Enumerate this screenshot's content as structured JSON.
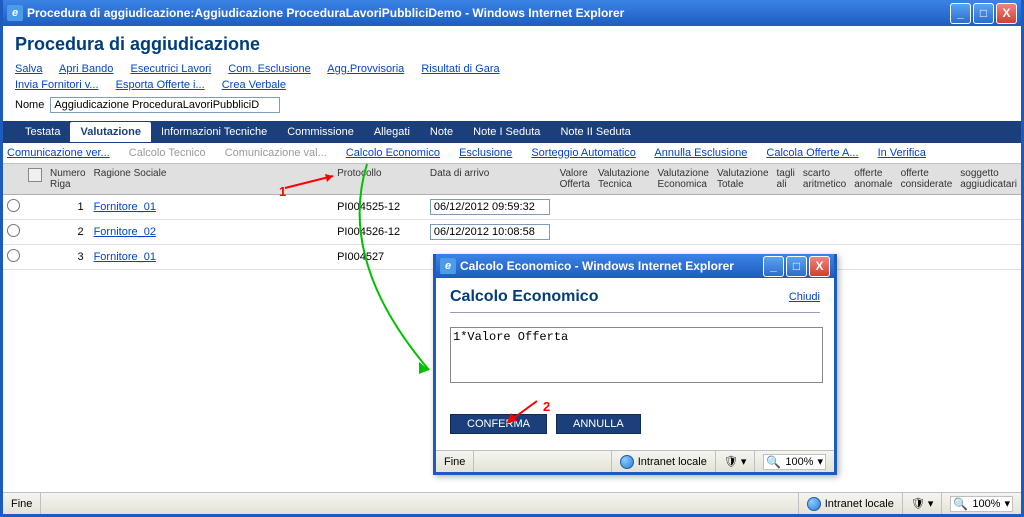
{
  "main_title": "Procedura di aggiudicazione:Aggiudicazione ProceduraLavoriPubbliciDemo - Windows Internet Explorer",
  "page_heading": "Procedura di aggiudicazione",
  "toolbar1": [
    "Salva",
    "Apri Bando",
    "Esecutrici Lavori",
    "Com. Esclusione",
    "Agg.Provvisoria",
    "Risultati di Gara"
  ],
  "toolbar2": [
    "Invia Fornitori v...",
    "Esporta Offerte i...",
    "Crea Verbale"
  ],
  "nome_label": "Nome",
  "nome_value": "Aggiudicazione ProceduraLavoriPubbliciD",
  "tabs": [
    "Testata",
    "Valutazione",
    "Informazioni Tecniche",
    "Commissione",
    "Allegati",
    "Note",
    "Note I Seduta",
    "Note II Seduta"
  ],
  "active_tab": "Valutazione",
  "sublinks": [
    {
      "label": "Comunicazione ver...",
      "disabled": false
    },
    {
      "label": "Calcolo Tecnico",
      "disabled": true
    },
    {
      "label": "Comunicazione val...",
      "disabled": true
    },
    {
      "label": "Calcolo Economico",
      "disabled": false
    },
    {
      "label": "Esclusione",
      "disabled": false
    },
    {
      "label": "Sorteggio Automatico",
      "disabled": false
    },
    {
      "label": "Annulla Esclusione",
      "disabled": false
    },
    {
      "label": "Calcola Offerte A...",
      "disabled": false
    },
    {
      "label": "In Verifica",
      "disabled": false
    }
  ],
  "grid_headers": [
    "",
    "",
    "Numero Riga",
    "Ragione Sociale",
    "Protocollo",
    "Data di arrivo",
    "Valore Offerta",
    "Valutazione Tecnica",
    "Valutazione Economica",
    "Valutazione Totale",
    "tagli ali",
    "scarto aritmetico",
    "offerte anomale",
    "offerte considerate",
    "soggetto aggiudicatari"
  ],
  "rows": [
    {
      "num": "1",
      "ragione": "Fornitore_01",
      "protocollo": "PI004525-12",
      "data": "06/12/2012 09:59:32"
    },
    {
      "num": "2",
      "ragione": "Fornitore_02",
      "protocollo": "PI004526-12",
      "data": "06/12/2012 10:08:58"
    },
    {
      "num": "3",
      "ragione": "Fornitore_01",
      "protocollo": "PI004527",
      "data": ""
    }
  ],
  "status_fine": "Fine",
  "status_zone": "Intranet locale",
  "status_zoom": "100%",
  "popup": {
    "title": "Calcolo Economico - Windows Internet Explorer",
    "heading": "Calcolo Economico",
    "close": "Chiudi",
    "textarea": "1*Valore Offerta",
    "btn_ok": "CONFERMA",
    "btn_cancel": "ANNULLA",
    "status_fine": "Fine",
    "status_zone": "Intranet locale",
    "status_zoom": "100%"
  },
  "annot1": "1",
  "annot2": "2"
}
